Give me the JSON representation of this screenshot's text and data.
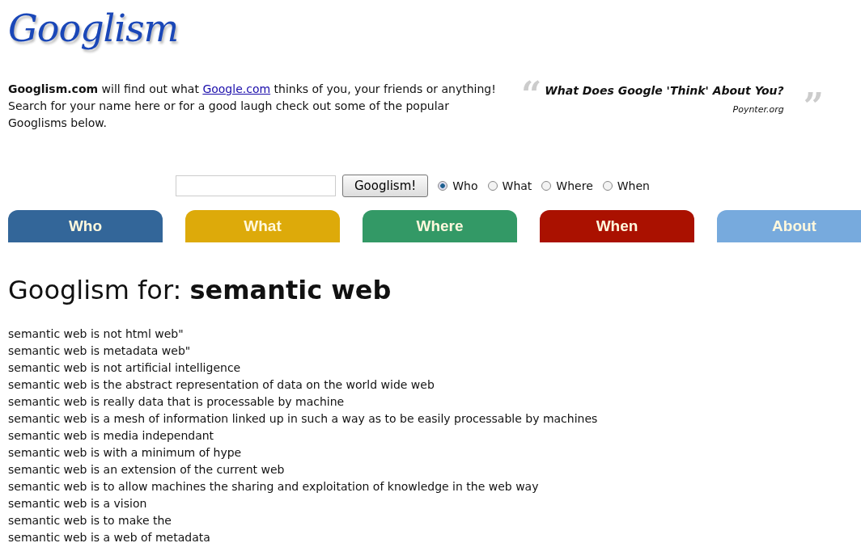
{
  "logo": "Googlism",
  "intro": {
    "text": "**Googlism.com** will find out what ",
    "link": "Google.com",
    "rest": " thinks of you, your friends or anything! Search for your name here or for a good laugh check out some of the popular Googlisms below."
  },
  "quote": {
    "open_mark": "“",
    "text": "What Does Google 'Think' About You?",
    "source": "Poynter.org",
    "close_mark": "”"
  },
  "search": {
    "button": "Googlism!",
    "options": [
      {
        "label": "Who",
        "selected": true
      },
      {
        "label": "What",
        "selected": false
      },
      {
        "label": "Where",
        "selected": false
      },
      {
        "label": "When",
        "selected": false
      }
    ]
  },
  "tabs": [
    {
      "label": "Who",
      "color": "#336699"
    },
    {
      "label": "What",
      "color": "#ddaa0a"
    },
    {
      "label": "Where",
      "color": "#339966"
    },
    {
      "label": "When",
      "color": "#aa1100"
    },
    {
      "label": "About",
      "color": "#77aadd"
    }
  ],
  "heading": {
    "prefix": "Googlism for: ",
    "term": "semantic web"
  },
  "results": [
    "semantic web is not html web\"",
    "semantic web is metadata web\"",
    "semantic web is not artificial intelligence",
    "semantic web is the abstract representation of data on the world wide web",
    "semantic web is really data that is processable by machine",
    "semantic web is a mesh of information linked up in such a way as to be easily processable by machines",
    "semantic web is media independant",
    "semantic web is with a minimum of hype",
    "semantic web is an extension of the current web",
    "semantic web is to allow machines the sharing and exploitation of knowledge in the web way",
    "semantic web is a vision",
    "semantic web is to make the",
    "semantic web is a web of metadata"
  ]
}
